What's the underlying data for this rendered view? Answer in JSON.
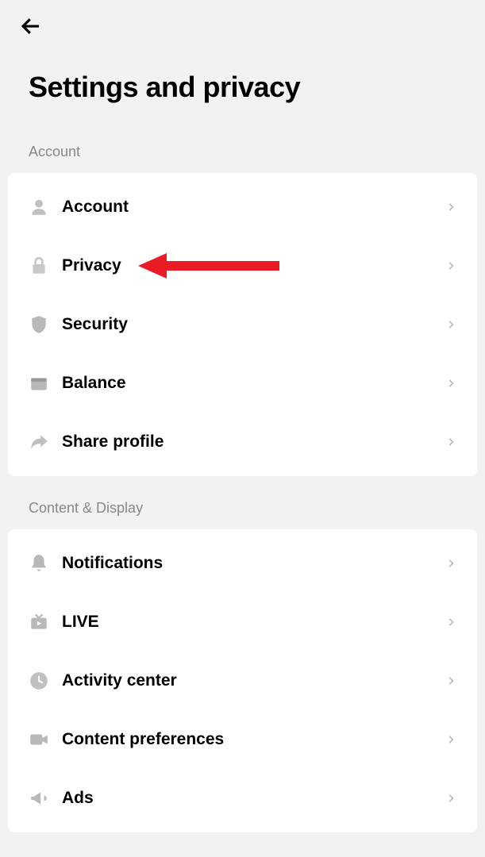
{
  "header": {
    "title": "Settings and privacy"
  },
  "sections": [
    {
      "header": "Account",
      "items": [
        {
          "label": "Account",
          "icon": "person"
        },
        {
          "label": "Privacy",
          "icon": "lock",
          "highlighted": true
        },
        {
          "label": "Security",
          "icon": "shield"
        },
        {
          "label": "Balance",
          "icon": "wallet"
        },
        {
          "label": "Share profile",
          "icon": "share"
        }
      ]
    },
    {
      "header": "Content & Display",
      "items": [
        {
          "label": "Notifications",
          "icon": "bell"
        },
        {
          "label": "LIVE",
          "icon": "tv"
        },
        {
          "label": "Activity center",
          "icon": "clock"
        },
        {
          "label": "Content preferences",
          "icon": "video"
        },
        {
          "label": "Ads",
          "icon": "megaphone"
        }
      ]
    }
  ]
}
